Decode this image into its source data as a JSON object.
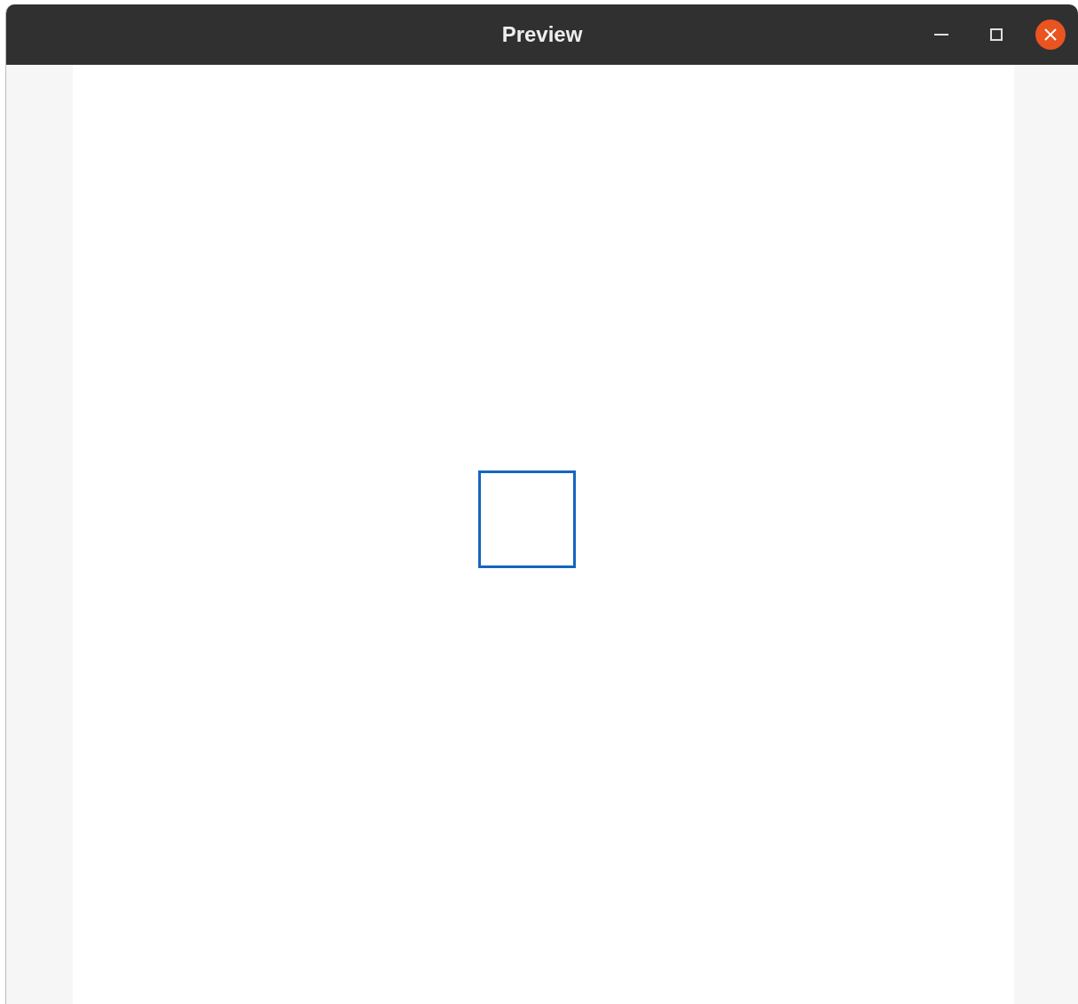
{
  "window": {
    "title": "Preview"
  }
}
